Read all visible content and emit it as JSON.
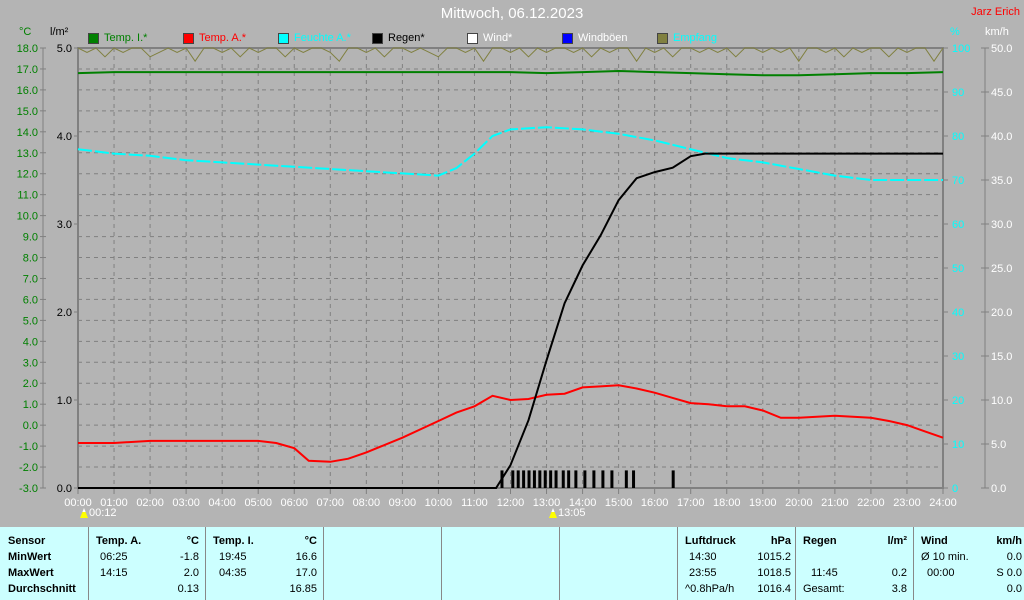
{
  "header": {
    "title": "Mittwoch, 06.12.2023",
    "author": "Jarz Erich"
  },
  "legend": [
    {
      "label": "Temp. I.*",
      "color": "#008000",
      "text_color": "#008000"
    },
    {
      "label": "Temp. A.*",
      "color": "#ff0000",
      "text_color": "#ff0000"
    },
    {
      "label": "Feuchte A.*",
      "color": "#00ffff",
      "text_color": "#00ffff"
    },
    {
      "label": "Regen*",
      "color": "#000000",
      "text_color": "#000000"
    },
    {
      "label": "Wind*",
      "color": "#ffffff",
      "text_color": "#ffffff"
    },
    {
      "label": "Windböen",
      "color": "#0000ff",
      "text_color": "#ffffff"
    },
    {
      "label": "Empfang",
      "color": "#808040",
      "text_color": "#00ffff"
    }
  ],
  "axes_units": {
    "temp": "°C",
    "rain": "l/m²",
    "humidity": "%",
    "wind": "km/h"
  },
  "moon_events": [
    {
      "label": "00:12"
    },
    {
      "label": "13:05"
    }
  ],
  "chart_data": {
    "type": "line",
    "title": "Mittwoch, 06.12.2023",
    "x_ticks": [
      "00:00",
      "01:00",
      "02:00",
      "03:00",
      "04:00",
      "05:00",
      "06:00",
      "07:00",
      "08:00",
      "09:00",
      "10:00",
      "11:00",
      "12:00",
      "13:00",
      "14:00",
      "15:00",
      "16:00",
      "17:00",
      "18:00",
      "19:00",
      "20:00",
      "21:00",
      "22:00",
      "23:00",
      "24:00"
    ],
    "xlim": [
      0,
      24
    ],
    "temp_axis": {
      "ylim": [
        -3,
        18
      ],
      "ticks": [
        "18.0",
        "17.0",
        "16.0",
        "15.0",
        "14.0",
        "13.0",
        "12.0",
        "11.0",
        "10.0",
        "9.0",
        "8.0",
        "7.0",
        "6.0",
        "5.0",
        "4.0",
        "3.0",
        "2.0",
        "1.0",
        "0.0",
        "-1.0",
        "-2.0",
        "-3.0"
      ]
    },
    "rain_axis": {
      "ylim": [
        0,
        5
      ],
      "ticks": [
        "5.0",
        "4.0",
        "3.0",
        "2.0",
        "1.0",
        "0.0"
      ]
    },
    "humidity_axis": {
      "ylim": [
        0,
        100
      ],
      "ticks": [
        "100",
        "90",
        "80",
        "70",
        "60",
        "50",
        "40",
        "30",
        "20",
        "10",
        "0"
      ]
    },
    "wind_axis": {
      "ylim": [
        0,
        50
      ],
      "ticks": [
        "50.0",
        "45.0",
        "40.0",
        "35.0",
        "30.0",
        "25.0",
        "20.0",
        "15.0",
        "10.0",
        "5.0",
        "0.0"
      ]
    },
    "grid": true,
    "series": [
      {
        "name": "Temp. I.*",
        "axis": "temp",
        "color": "#008000",
        "x": [
          0,
          1,
          3,
          6,
          9,
          11,
          12,
          13,
          14,
          15,
          16,
          17,
          18,
          19,
          20,
          21,
          22,
          23,
          24
        ],
        "y": [
          16.8,
          16.85,
          16.85,
          16.85,
          16.85,
          16.85,
          16.85,
          16.8,
          16.85,
          16.9,
          16.85,
          16.8,
          16.75,
          16.7,
          16.7,
          16.75,
          16.8,
          16.8,
          16.85
        ]
      },
      {
        "name": "Temp. A.*",
        "axis": "temp",
        "color": "#ff0000",
        "x": [
          0,
          1,
          2,
          3,
          4,
          5,
          5.5,
          6,
          6.4,
          7,
          7.5,
          8,
          9,
          10,
          10.5,
          11,
          11.5,
          12,
          12.5,
          13,
          13.5,
          14,
          14.5,
          15,
          15.5,
          16,
          16.5,
          17,
          17.5,
          18,
          18.5,
          19,
          19.5,
          20,
          21,
          22,
          22.5,
          23,
          23.5,
          24
        ],
        "y": [
          -0.85,
          -0.85,
          -0.75,
          -0.75,
          -0.75,
          -0.75,
          -0.85,
          -1.1,
          -1.7,
          -1.75,
          -1.6,
          -1.3,
          -0.6,
          0.2,
          0.6,
          0.9,
          1.4,
          1.2,
          1.25,
          1.45,
          1.5,
          1.8,
          1.85,
          1.9,
          1.75,
          1.55,
          1.3,
          1.05,
          1.0,
          0.9,
          0.9,
          0.7,
          0.35,
          0.35,
          0.45,
          0.35,
          0.2,
          0.0,
          -0.3,
          -0.6
        ]
      },
      {
        "name": "Feuchte A.*",
        "axis": "humidity",
        "color": "#00ffff",
        "x": [
          0,
          1,
          2,
          3,
          4,
          5,
          6,
          7,
          8,
          9,
          10,
          10.5,
          11,
          11.5,
          12,
          13,
          14,
          15,
          16,
          17,
          18,
          19,
          20,
          21,
          22,
          23,
          24
        ],
        "y": [
          77,
          76,
          75.5,
          74.5,
          74,
          73.5,
          73,
          72.5,
          72,
          71.5,
          71,
          72.7,
          76,
          80,
          81.5,
          82,
          81.5,
          80.5,
          79,
          77,
          75,
          74,
          72.5,
          71,
          70,
          70,
          70
        ]
      },
      {
        "name": "Regen*",
        "axis": "rain",
        "color": "#000000",
        "x": [
          0,
          11.6,
          12,
          12.5,
          13,
          13.5,
          14,
          14.5,
          15,
          15.5,
          16,
          16.5,
          17,
          17.4,
          24
        ],
        "y": [
          0,
          0,
          0.26,
          0.77,
          1.45,
          2.1,
          2.53,
          2.87,
          3.27,
          3.52,
          3.59,
          3.64,
          3.77,
          3.8,
          3.8
        ]
      },
      {
        "name": "Regen bars",
        "axis": "rain",
        "color": "#000000",
        "type": "bar",
        "x": [
          11.75,
          12.05,
          12.2,
          12.35,
          12.5,
          12.65,
          12.8,
          12.95,
          13.1,
          13.25,
          13.45,
          13.6,
          13.8,
          14.05,
          14.3,
          14.55,
          14.8,
          15.2,
          15.4,
          16.5
        ],
        "y": [
          0.2,
          0.2,
          0.2,
          0.2,
          0.2,
          0.2,
          0.2,
          0.2,
          0.2,
          0.2,
          0.2,
          0.2,
          0.2,
          0.2,
          0.2,
          0.2,
          0.2,
          0.2,
          0.2,
          0.2
        ]
      },
      {
        "name": "Empfang",
        "axis": "humidity",
        "color": "#808040",
        "step": 0.25,
        "y": [
          100,
          99,
          100,
          98,
          100,
          99,
          100,
          100,
          98,
          99,
          100,
          99,
          100,
          97,
          100,
          100,
          99,
          100,
          98,
          100,
          99,
          100,
          100,
          98,
          100,
          99,
          100,
          100,
          99,
          97,
          100,
          100,
          99,
          100,
          98,
          100,
          100,
          99,
          100,
          99,
          98,
          100,
          100,
          99,
          100,
          97,
          100,
          100,
          99,
          100,
          98,
          100,
          99,
          100,
          100,
          99,
          100,
          98,
          100,
          99,
          100,
          100,
          97,
          100,
          99,
          100,
          98,
          100,
          100,
          99,
          100,
          99,
          100,
          98,
          100,
          100,
          99,
          100,
          99,
          100,
          97,
          100,
          100,
          99,
          100,
          98,
          100,
          99,
          100,
          100,
          98,
          100,
          99,
          100,
          100,
          97,
          100
        ]
      }
    ]
  },
  "table": {
    "temp_a": {
      "header": "Temp. A.",
      "unit": "°C",
      "min_time": "06:25",
      "min": "-1.8",
      "max_time": "14:15",
      "max": "2.0",
      "avg": "0.13"
    },
    "temp_i": {
      "header": "Temp. I.",
      "unit": "°C",
      "min_time": "19:45",
      "min": "16.6",
      "max_time": "04:35",
      "max": "17.0",
      "avg": "16.85"
    },
    "rows": {
      "sensor": "Sensor",
      "min": "MinWert",
      "max": "MaxWert",
      "avg": "Durchschnitt"
    },
    "pressure": {
      "header": "Luftdruck",
      "unit": "hPa",
      "r1_time": "14:30",
      "r1": "1015.2",
      "r2_time": "23:55",
      "r2": "1018.5",
      "r3_label": "^0.8hPa/h",
      "r3": "1016.4"
    },
    "rain": {
      "header": "Regen",
      "unit": "l/m²",
      "r2_time": "11:45",
      "r2": "0.2",
      "r3_label": "Gesamt:",
      "r3": "3.8"
    },
    "wind": {
      "header": "Wind",
      "unit": "km/h",
      "r1_label": "Ø 10 min.",
      "r1": "0.0",
      "r2_time": "00:00",
      "r2": "S 0.0",
      "r3": "0.0"
    }
  }
}
